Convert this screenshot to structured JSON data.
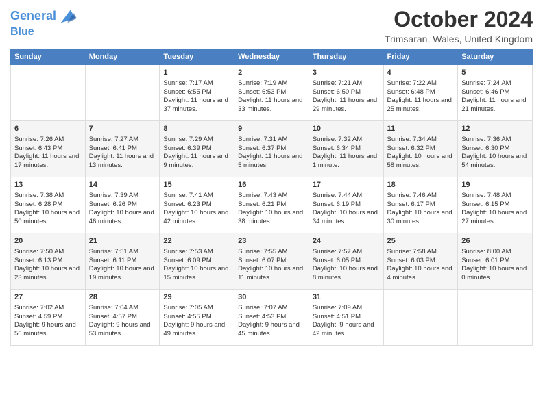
{
  "header": {
    "logo_line1": "General",
    "logo_line2": "Blue",
    "main_title": "October 2024",
    "subtitle": "Trimsaran, Wales, United Kingdom"
  },
  "days_of_week": [
    "Sunday",
    "Monday",
    "Tuesday",
    "Wednesday",
    "Thursday",
    "Friday",
    "Saturday"
  ],
  "weeks": [
    [
      {
        "day": "",
        "info": ""
      },
      {
        "day": "",
        "info": ""
      },
      {
        "day": "1",
        "info": "Sunrise: 7:17 AM\nSunset: 6:55 PM\nDaylight: 11 hours and 37 minutes."
      },
      {
        "day": "2",
        "info": "Sunrise: 7:19 AM\nSunset: 6:53 PM\nDaylight: 11 hours and 33 minutes."
      },
      {
        "day": "3",
        "info": "Sunrise: 7:21 AM\nSunset: 6:50 PM\nDaylight: 11 hours and 29 minutes."
      },
      {
        "day": "4",
        "info": "Sunrise: 7:22 AM\nSunset: 6:48 PM\nDaylight: 11 hours and 25 minutes."
      },
      {
        "day": "5",
        "info": "Sunrise: 7:24 AM\nSunset: 6:46 PM\nDaylight: 11 hours and 21 minutes."
      }
    ],
    [
      {
        "day": "6",
        "info": "Sunrise: 7:26 AM\nSunset: 6:43 PM\nDaylight: 11 hours and 17 minutes."
      },
      {
        "day": "7",
        "info": "Sunrise: 7:27 AM\nSunset: 6:41 PM\nDaylight: 11 hours and 13 minutes."
      },
      {
        "day": "8",
        "info": "Sunrise: 7:29 AM\nSunset: 6:39 PM\nDaylight: 11 hours and 9 minutes."
      },
      {
        "day": "9",
        "info": "Sunrise: 7:31 AM\nSunset: 6:37 PM\nDaylight: 11 hours and 5 minutes."
      },
      {
        "day": "10",
        "info": "Sunrise: 7:32 AM\nSunset: 6:34 PM\nDaylight: 11 hours and 1 minute."
      },
      {
        "day": "11",
        "info": "Sunrise: 7:34 AM\nSunset: 6:32 PM\nDaylight: 10 hours and 58 minutes."
      },
      {
        "day": "12",
        "info": "Sunrise: 7:36 AM\nSunset: 6:30 PM\nDaylight: 10 hours and 54 minutes."
      }
    ],
    [
      {
        "day": "13",
        "info": "Sunrise: 7:38 AM\nSunset: 6:28 PM\nDaylight: 10 hours and 50 minutes."
      },
      {
        "day": "14",
        "info": "Sunrise: 7:39 AM\nSunset: 6:26 PM\nDaylight: 10 hours and 46 minutes."
      },
      {
        "day": "15",
        "info": "Sunrise: 7:41 AM\nSunset: 6:23 PM\nDaylight: 10 hours and 42 minutes."
      },
      {
        "day": "16",
        "info": "Sunrise: 7:43 AM\nSunset: 6:21 PM\nDaylight: 10 hours and 38 minutes."
      },
      {
        "day": "17",
        "info": "Sunrise: 7:44 AM\nSunset: 6:19 PM\nDaylight: 10 hours and 34 minutes."
      },
      {
        "day": "18",
        "info": "Sunrise: 7:46 AM\nSunset: 6:17 PM\nDaylight: 10 hours and 30 minutes."
      },
      {
        "day": "19",
        "info": "Sunrise: 7:48 AM\nSunset: 6:15 PM\nDaylight: 10 hours and 27 minutes."
      }
    ],
    [
      {
        "day": "20",
        "info": "Sunrise: 7:50 AM\nSunset: 6:13 PM\nDaylight: 10 hours and 23 minutes."
      },
      {
        "day": "21",
        "info": "Sunrise: 7:51 AM\nSunset: 6:11 PM\nDaylight: 10 hours and 19 minutes."
      },
      {
        "day": "22",
        "info": "Sunrise: 7:53 AM\nSunset: 6:09 PM\nDaylight: 10 hours and 15 minutes."
      },
      {
        "day": "23",
        "info": "Sunrise: 7:55 AM\nSunset: 6:07 PM\nDaylight: 10 hours and 11 minutes."
      },
      {
        "day": "24",
        "info": "Sunrise: 7:57 AM\nSunset: 6:05 PM\nDaylight: 10 hours and 8 minutes."
      },
      {
        "day": "25",
        "info": "Sunrise: 7:58 AM\nSunset: 6:03 PM\nDaylight: 10 hours and 4 minutes."
      },
      {
        "day": "26",
        "info": "Sunrise: 8:00 AM\nSunset: 6:01 PM\nDaylight: 10 hours and 0 minutes."
      }
    ],
    [
      {
        "day": "27",
        "info": "Sunrise: 7:02 AM\nSunset: 4:59 PM\nDaylight: 9 hours and 56 minutes."
      },
      {
        "day": "28",
        "info": "Sunrise: 7:04 AM\nSunset: 4:57 PM\nDaylight: 9 hours and 53 minutes."
      },
      {
        "day": "29",
        "info": "Sunrise: 7:05 AM\nSunset: 4:55 PM\nDaylight: 9 hours and 49 minutes."
      },
      {
        "day": "30",
        "info": "Sunrise: 7:07 AM\nSunset: 4:53 PM\nDaylight: 9 hours and 45 minutes."
      },
      {
        "day": "31",
        "info": "Sunrise: 7:09 AM\nSunset: 4:51 PM\nDaylight: 9 hours and 42 minutes."
      },
      {
        "day": "",
        "info": ""
      },
      {
        "day": "",
        "info": ""
      }
    ]
  ]
}
